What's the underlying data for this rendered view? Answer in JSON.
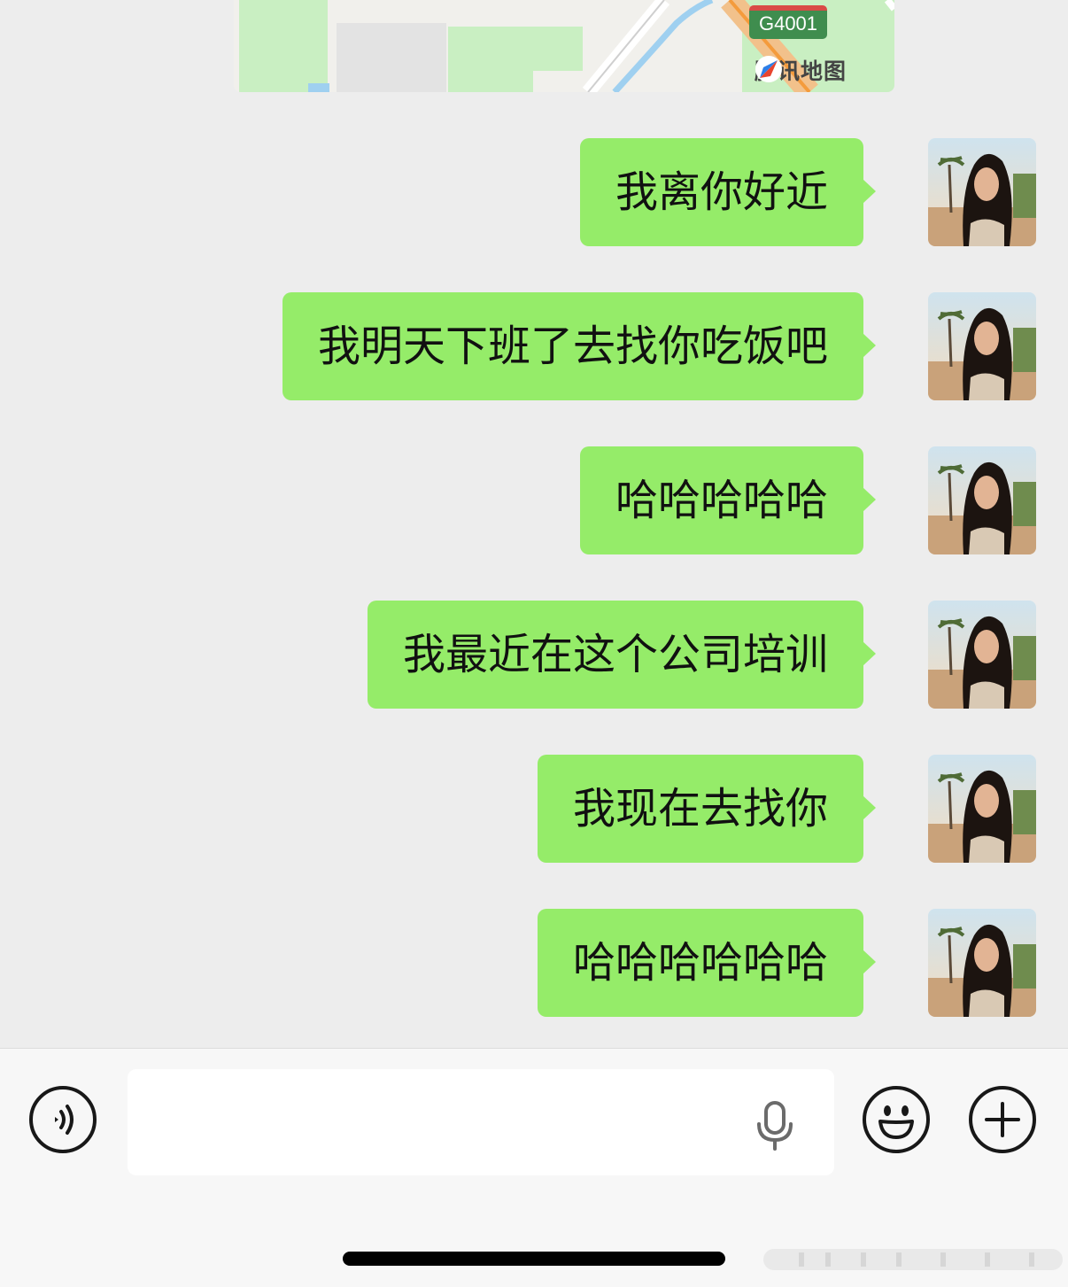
{
  "map": {
    "road_code": "G4001",
    "provider": "腾讯地图",
    "provider_icon": "tencent-map-logo-icon"
  },
  "messages": [
    {
      "text": "我离你好近",
      "sender": "self"
    },
    {
      "text": "我明天下班了去找你吃饭吧",
      "sender": "self"
    },
    {
      "text": "哈哈哈哈哈",
      "sender": "self"
    },
    {
      "text": "我最近在这个公司培训",
      "sender": "self"
    },
    {
      "text": "我现在去找你",
      "sender": "self"
    },
    {
      "text": "哈哈哈哈哈哈",
      "sender": "self"
    }
  ],
  "input_bar": {
    "voice_icon": "voice-mode-icon",
    "input_value": "",
    "mic_icon": "microphone-icon",
    "emoji_icon": "emoji-icon",
    "more_icon": "plus-icon"
  },
  "colors": {
    "chat_background": "#ededed",
    "bubble_green": "#95ec69",
    "input_bar_background": "#f7f7f7"
  }
}
